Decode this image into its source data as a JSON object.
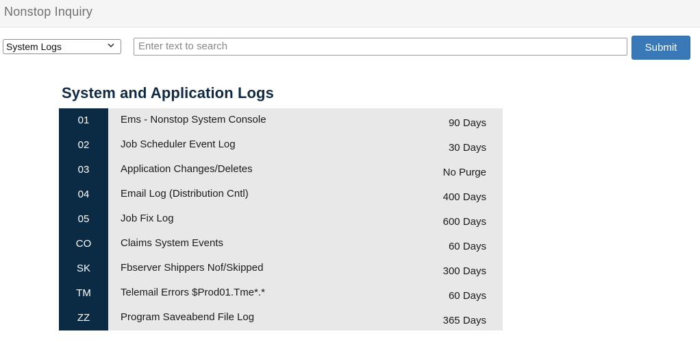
{
  "app": {
    "title": "Nonstop Inquiry"
  },
  "toolbar": {
    "select_value": "System Logs",
    "search_placeholder": "Enter text to search",
    "submit_label": "Submit"
  },
  "panel": {
    "title": "System and Application Logs"
  },
  "logs": [
    {
      "code": "01",
      "description": "Ems - Nonstop System Console",
      "retention": "90 Days"
    },
    {
      "code": "02",
      "description": "Job Scheduler Event Log",
      "retention": "30 Days"
    },
    {
      "code": "03",
      "description": "Application Changes/Deletes",
      "retention": "No Purge"
    },
    {
      "code": "04",
      "description": "Email Log (Distribution Cntl)",
      "retention": "400 Days"
    },
    {
      "code": "05",
      "description": "Job Fix Log",
      "retention": "600 Days"
    },
    {
      "code": "CO",
      "description": "Claims System Events",
      "retention": "60 Days"
    },
    {
      "code": "SK",
      "description": "Fbserver Shippers Nof/Skipped",
      "retention": "300 Days"
    },
    {
      "code": "TM",
      "description": "Telemail Errors $Prod01.Tme*.*",
      "retention": "60 Days"
    },
    {
      "code": "ZZ",
      "description": "Program Saveabend File Log",
      "retention": "365 Days"
    }
  ],
  "colors": {
    "code_column_bg": "#0b2b45",
    "row_bg": "#e8e8e8",
    "submit_bg": "#3a79b8",
    "title_color": "#0f2a42"
  }
}
